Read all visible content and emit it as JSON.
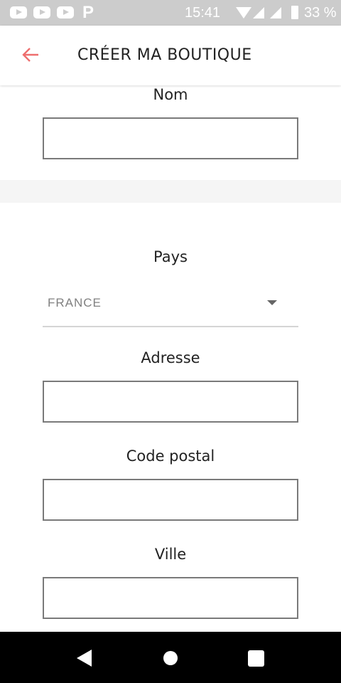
{
  "status_bar": {
    "time": "15:41",
    "battery": "33 %",
    "notification_icons": [
      "youtube-icon",
      "youtube-icon",
      "youtube-icon",
      "p-icon"
    ]
  },
  "header": {
    "title": "CRÉER MA BOUTIQUE",
    "back_icon": "arrow-left-icon",
    "accent": "#ee6e6e"
  },
  "form": {
    "name_label": "Nom",
    "name_value": "",
    "country_label": "Pays",
    "country_value": "FRANCE",
    "address_label": "Adresse",
    "address_value": "",
    "postal_label": "Code postal",
    "postal_value": "",
    "city_label": "Ville",
    "city_value": ""
  }
}
